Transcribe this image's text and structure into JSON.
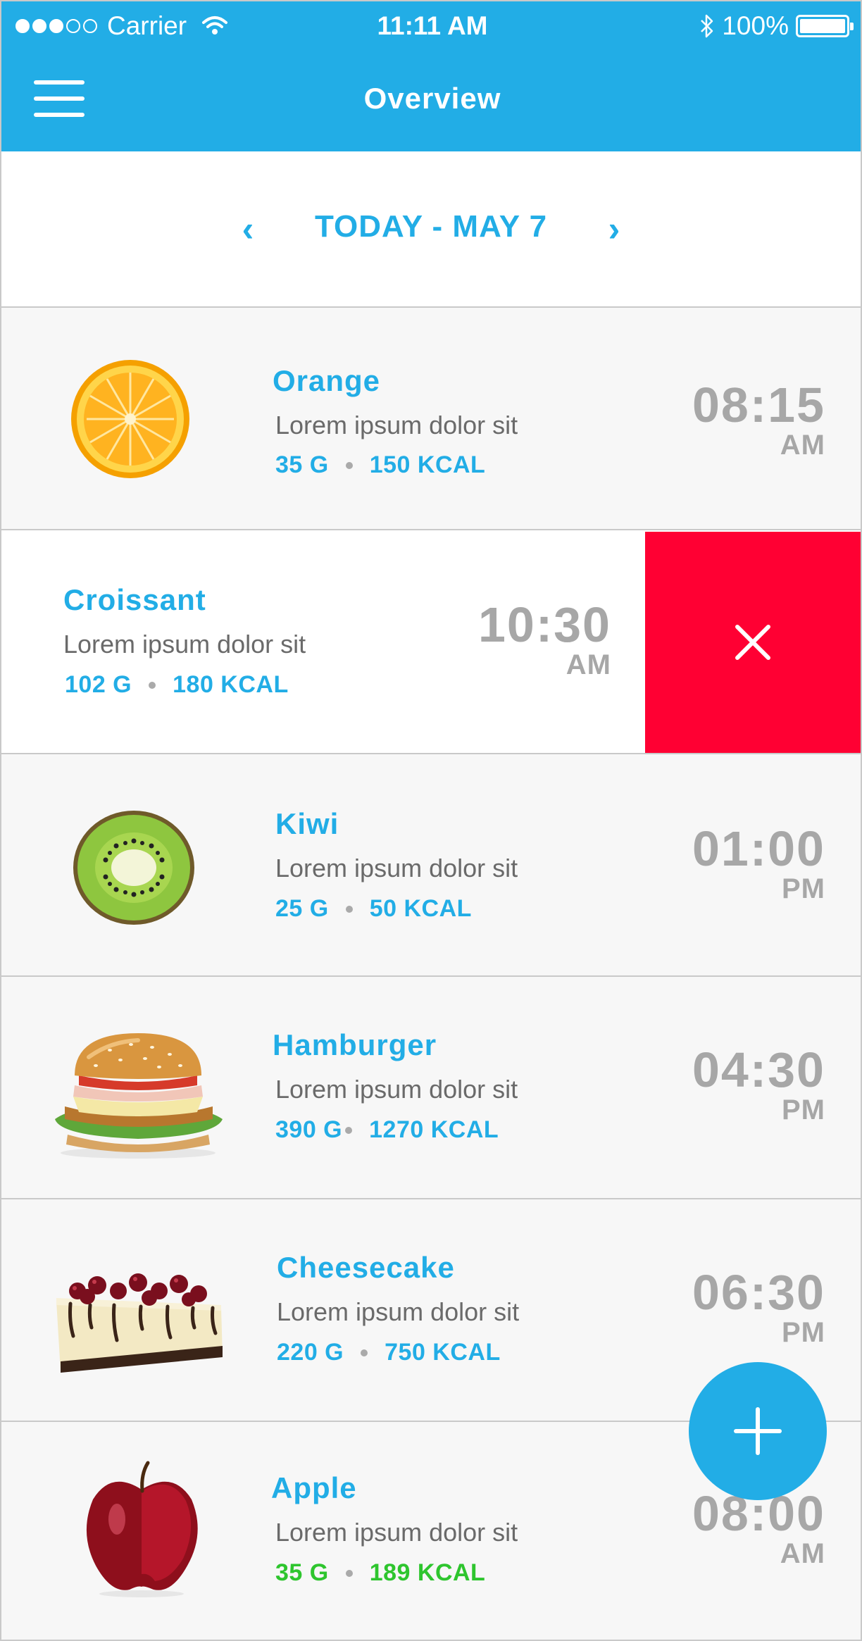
{
  "status_bar": {
    "carrier": "Carrier",
    "time": "11:11 AM",
    "battery": "100%",
    "signal_dots_filled": 3,
    "signal_dots_total": 5
  },
  "header": {
    "title": "Overview",
    "menu_icon": "hamburger-menu-icon"
  },
  "date_nav": {
    "label": "TODAY - MAY 7",
    "prev_icon": "chevron-left-icon",
    "next_icon": "chevron-right-icon"
  },
  "meals": [
    {
      "name": "Orange",
      "desc": "Lorem ipsum dolor sit",
      "grams": "35 G",
      "kcal": "150 KCAL",
      "time": "08:15",
      "ampm": "AM",
      "image": "orange-image"
    },
    {
      "name": "Croissant",
      "desc": "Lorem ipsum dolor sit",
      "grams": "102 G",
      "kcal": "180 KCAL",
      "time": "10:30",
      "ampm": "AM",
      "image": "croissant-image",
      "swiped": true,
      "delete_icon": "close-icon"
    },
    {
      "name": "Kiwi",
      "desc": "Lorem ipsum dolor sit",
      "grams": "25 G",
      "kcal": "50 KCAL",
      "time": "01:00",
      "ampm": "PM",
      "image": "kiwi-image"
    },
    {
      "name": "Hamburger",
      "desc": "Lorem ipsum dolor sit",
      "grams": "390 G",
      "kcal": "1270 KCAL",
      "time": "04:30",
      "ampm": "PM",
      "image": "hamburger-image"
    },
    {
      "name": "Cheesecake",
      "desc": "Lorem ipsum dolor sit",
      "grams": "220 G",
      "kcal": "750 KCAL",
      "time": "06:30",
      "ampm": "PM",
      "image": "cheesecake-image"
    },
    {
      "name": "Apple",
      "desc": "Lorem ipsum dolor sit",
      "grams": "35 G",
      "kcal": "189 KCAL",
      "time": "08:00",
      "ampm": "AM",
      "image": "apple-image"
    }
  ],
  "fab": {
    "icon": "plus-icon"
  },
  "colors": {
    "accent": "#22ade6",
    "delete": "#ff0033",
    "time_gray": "#a7a7a7",
    "highlight_green": "#2ec52e"
  }
}
